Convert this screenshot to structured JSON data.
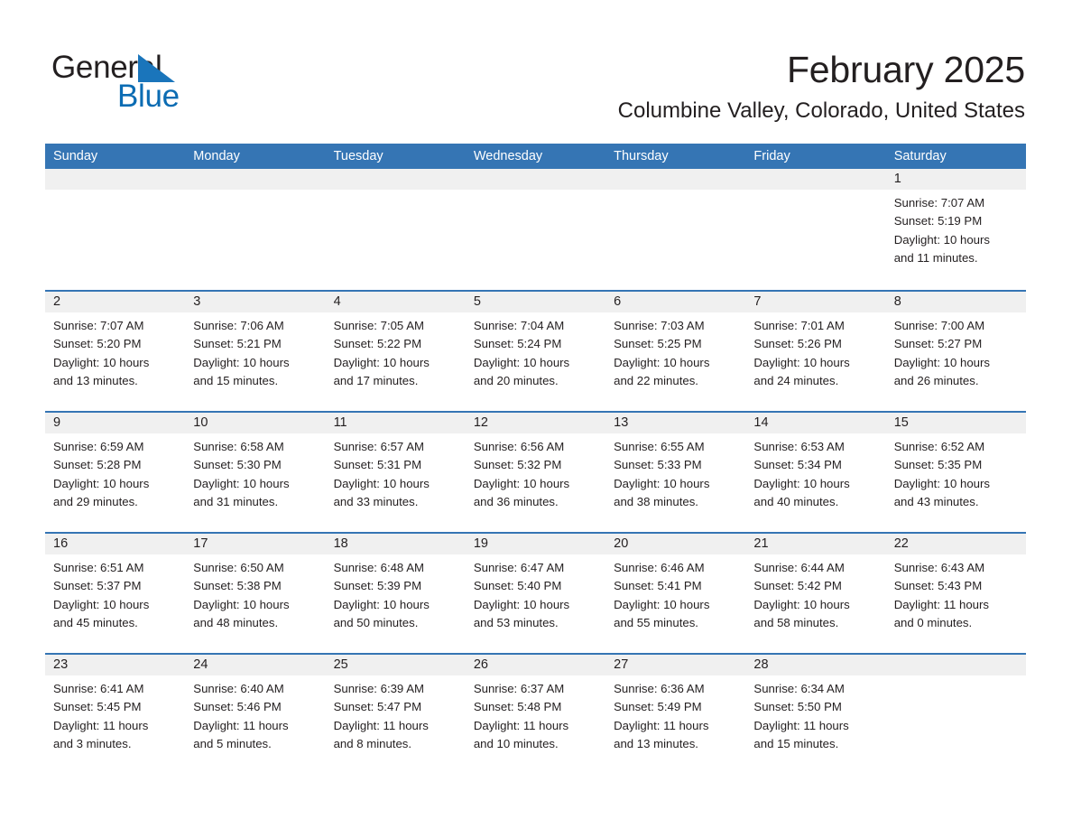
{
  "logo": {
    "text_dark": "General",
    "text_blue": "Blue",
    "triangle_color": "#1a75bb",
    "blue_color": "#0b6cb3"
  },
  "header": {
    "title": "February 2025",
    "subtitle": "Columbine Valley, Colorado, United States"
  },
  "theme": {
    "accent": "#3575b4",
    "daynum_strip": "#f0f0f0",
    "text": "#231f20"
  },
  "calendar": {
    "weekdays": [
      "Sunday",
      "Monday",
      "Tuesday",
      "Wednesday",
      "Thursday",
      "Friday",
      "Saturday"
    ],
    "weeks": [
      [
        null,
        null,
        null,
        null,
        null,
        null,
        {
          "day": "1",
          "lines": [
            "Sunrise: 7:07 AM",
            "Sunset: 5:19 PM",
            "Daylight: 10 hours",
            "and 11 minutes."
          ]
        }
      ],
      [
        {
          "day": "2",
          "lines": [
            "Sunrise: 7:07 AM",
            "Sunset: 5:20 PM",
            "Daylight: 10 hours",
            "and 13 minutes."
          ]
        },
        {
          "day": "3",
          "lines": [
            "Sunrise: 7:06 AM",
            "Sunset: 5:21 PM",
            "Daylight: 10 hours",
            "and 15 minutes."
          ]
        },
        {
          "day": "4",
          "lines": [
            "Sunrise: 7:05 AM",
            "Sunset: 5:22 PM",
            "Daylight: 10 hours",
            "and 17 minutes."
          ]
        },
        {
          "day": "5",
          "lines": [
            "Sunrise: 7:04 AM",
            "Sunset: 5:24 PM",
            "Daylight: 10 hours",
            "and 20 minutes."
          ]
        },
        {
          "day": "6",
          "lines": [
            "Sunrise: 7:03 AM",
            "Sunset: 5:25 PM",
            "Daylight: 10 hours",
            "and 22 minutes."
          ]
        },
        {
          "day": "7",
          "lines": [
            "Sunrise: 7:01 AM",
            "Sunset: 5:26 PM",
            "Daylight: 10 hours",
            "and 24 minutes."
          ]
        },
        {
          "day": "8",
          "lines": [
            "Sunrise: 7:00 AM",
            "Sunset: 5:27 PM",
            "Daylight: 10 hours",
            "and 26 minutes."
          ]
        }
      ],
      [
        {
          "day": "9",
          "lines": [
            "Sunrise: 6:59 AM",
            "Sunset: 5:28 PM",
            "Daylight: 10 hours",
            "and 29 minutes."
          ]
        },
        {
          "day": "10",
          "lines": [
            "Sunrise: 6:58 AM",
            "Sunset: 5:30 PM",
            "Daylight: 10 hours",
            "and 31 minutes."
          ]
        },
        {
          "day": "11",
          "lines": [
            "Sunrise: 6:57 AM",
            "Sunset: 5:31 PM",
            "Daylight: 10 hours",
            "and 33 minutes."
          ]
        },
        {
          "day": "12",
          "lines": [
            "Sunrise: 6:56 AM",
            "Sunset: 5:32 PM",
            "Daylight: 10 hours",
            "and 36 minutes."
          ]
        },
        {
          "day": "13",
          "lines": [
            "Sunrise: 6:55 AM",
            "Sunset: 5:33 PM",
            "Daylight: 10 hours",
            "and 38 minutes."
          ]
        },
        {
          "day": "14",
          "lines": [
            "Sunrise: 6:53 AM",
            "Sunset: 5:34 PM",
            "Daylight: 10 hours",
            "and 40 minutes."
          ]
        },
        {
          "day": "15",
          "lines": [
            "Sunrise: 6:52 AM",
            "Sunset: 5:35 PM",
            "Daylight: 10 hours",
            "and 43 minutes."
          ]
        }
      ],
      [
        {
          "day": "16",
          "lines": [
            "Sunrise: 6:51 AM",
            "Sunset: 5:37 PM",
            "Daylight: 10 hours",
            "and 45 minutes."
          ]
        },
        {
          "day": "17",
          "lines": [
            "Sunrise: 6:50 AM",
            "Sunset: 5:38 PM",
            "Daylight: 10 hours",
            "and 48 minutes."
          ]
        },
        {
          "day": "18",
          "lines": [
            "Sunrise: 6:48 AM",
            "Sunset: 5:39 PM",
            "Daylight: 10 hours",
            "and 50 minutes."
          ]
        },
        {
          "day": "19",
          "lines": [
            "Sunrise: 6:47 AM",
            "Sunset: 5:40 PM",
            "Daylight: 10 hours",
            "and 53 minutes."
          ]
        },
        {
          "day": "20",
          "lines": [
            "Sunrise: 6:46 AM",
            "Sunset: 5:41 PM",
            "Daylight: 10 hours",
            "and 55 minutes."
          ]
        },
        {
          "day": "21",
          "lines": [
            "Sunrise: 6:44 AM",
            "Sunset: 5:42 PM",
            "Daylight: 10 hours",
            "and 58 minutes."
          ]
        },
        {
          "day": "22",
          "lines": [
            "Sunrise: 6:43 AM",
            "Sunset: 5:43 PM",
            "Daylight: 11 hours",
            "and 0 minutes."
          ]
        }
      ],
      [
        {
          "day": "23",
          "lines": [
            "Sunrise: 6:41 AM",
            "Sunset: 5:45 PM",
            "Daylight: 11 hours",
            "and 3 minutes."
          ]
        },
        {
          "day": "24",
          "lines": [
            "Sunrise: 6:40 AM",
            "Sunset: 5:46 PM",
            "Daylight: 11 hours",
            "and 5 minutes."
          ]
        },
        {
          "day": "25",
          "lines": [
            "Sunrise: 6:39 AM",
            "Sunset: 5:47 PM",
            "Daylight: 11 hours",
            "and 8 minutes."
          ]
        },
        {
          "day": "26",
          "lines": [
            "Sunrise: 6:37 AM",
            "Sunset: 5:48 PM",
            "Daylight: 11 hours",
            "and 10 minutes."
          ]
        },
        {
          "day": "27",
          "lines": [
            "Sunrise: 6:36 AM",
            "Sunset: 5:49 PM",
            "Daylight: 11 hours",
            "and 13 minutes."
          ]
        },
        {
          "day": "28",
          "lines": [
            "Sunrise: 6:34 AM",
            "Sunset: 5:50 PM",
            "Daylight: 11 hours",
            "and 15 minutes."
          ]
        },
        null
      ]
    ]
  }
}
